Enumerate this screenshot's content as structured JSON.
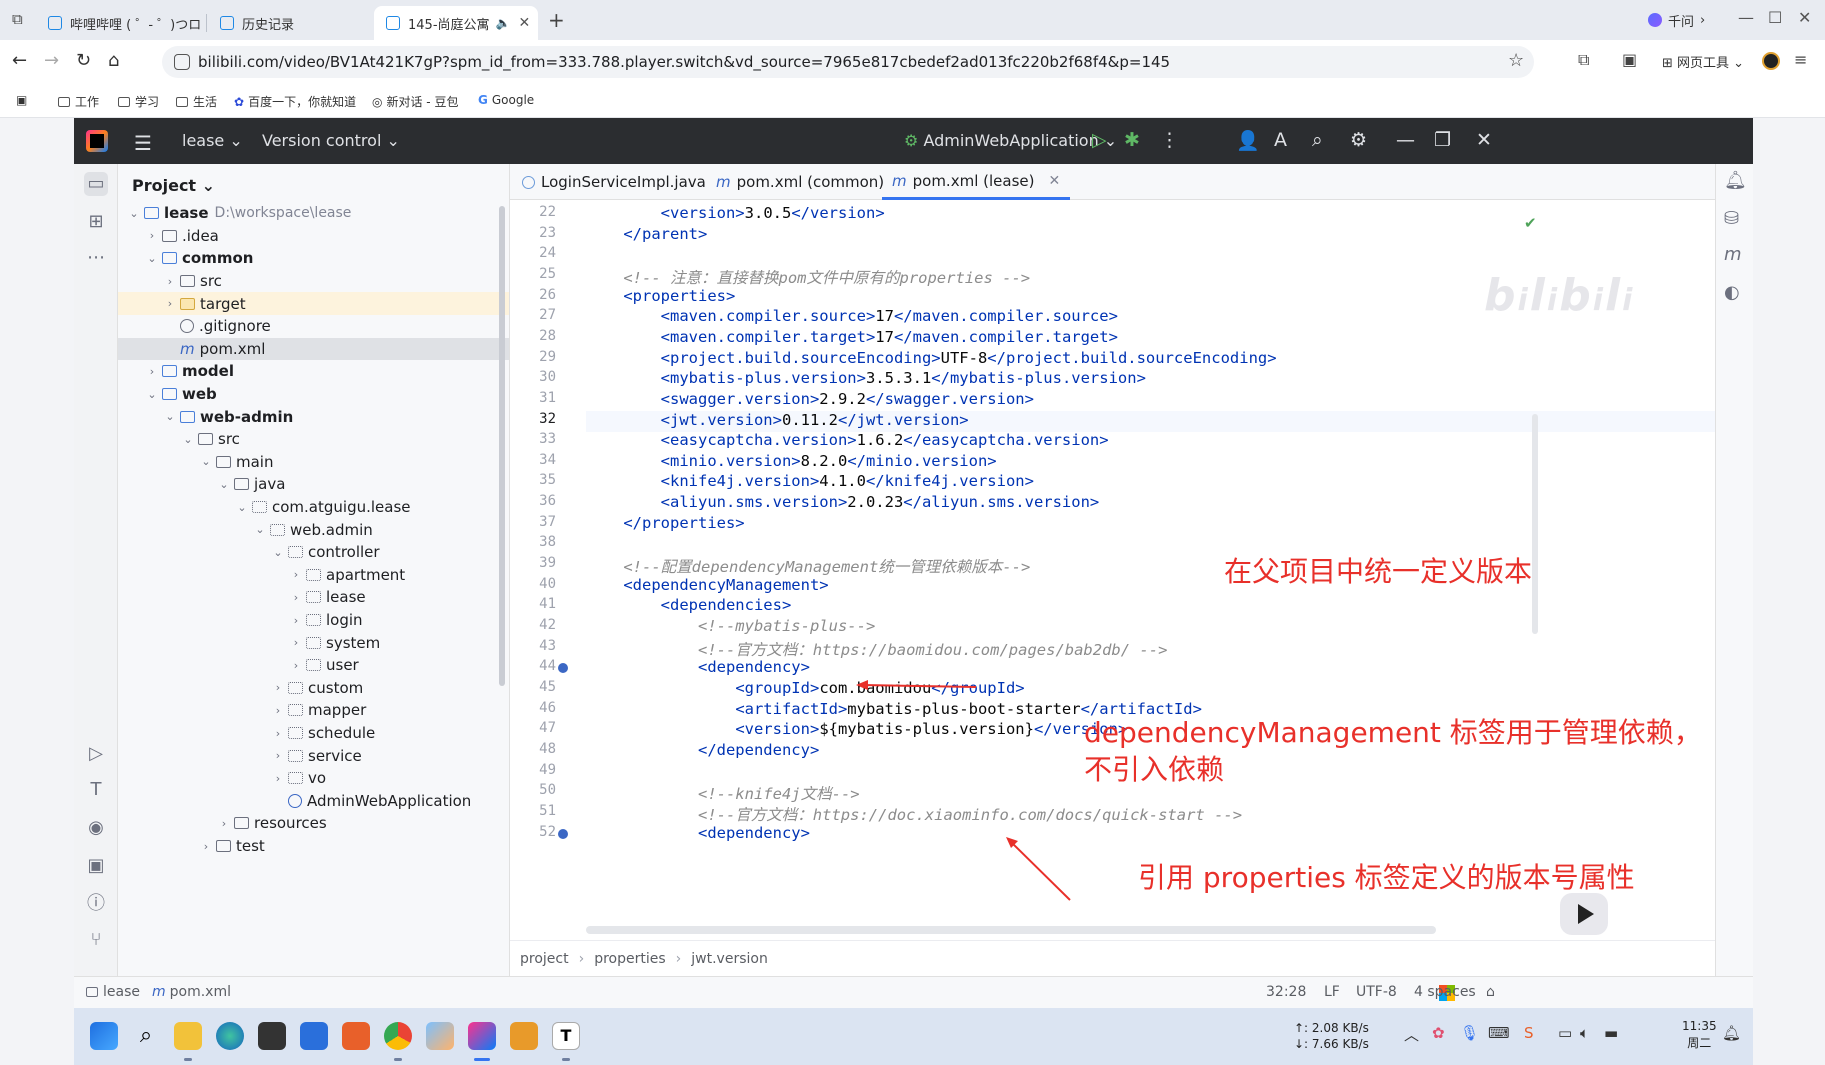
{
  "browser": {
    "tabs": [
      {
        "label": "哔哩哔哩 ( ゜- ゜)つロ",
        "active": false
      },
      {
        "label": "历史记录",
        "active": false
      },
      {
        "label": "145-尚庭公寓",
        "active": true
      }
    ],
    "qianwen_label": "千问",
    "url": "bilibili.com/video/BV1At421K7gP?spm_id_from=333.788.player.switch&vd_source=7965e817cbedef2ad013fc220b2f68f4&p=145",
    "webtools_label": "网页工具",
    "bookmarks": [
      "工作",
      "学习",
      "生活",
      "百度一下，你就知道",
      "新对话 - 豆包",
      "Google"
    ]
  },
  "ide": {
    "project_menu": "lease",
    "vcs_menu": "Version control",
    "run_config": "AdminWebApplication",
    "panel_title": "Project",
    "tree": [
      {
        "label": "lease",
        "path": "D:\\workspace\\lease",
        "depth": 0,
        "icon": "module",
        "open": true,
        "bold": true
      },
      {
        "label": ".idea",
        "depth": 1,
        "icon": "folder",
        "open": false
      },
      {
        "label": "common",
        "depth": 1,
        "icon": "module",
        "open": true,
        "bold": true
      },
      {
        "label": "src",
        "depth": 2,
        "icon": "folder",
        "open": false
      },
      {
        "label": "target",
        "depth": 2,
        "icon": "target",
        "open": false,
        "excluded": true
      },
      {
        "label": ".gitignore",
        "depth": 2,
        "icon": "ignore",
        "leaf": true
      },
      {
        "label": "pom.xml",
        "depth": 2,
        "icon": "maven",
        "leaf": true,
        "selected": true
      },
      {
        "label": "model",
        "depth": 1,
        "icon": "module",
        "open": false,
        "bold": true
      },
      {
        "label": "web",
        "depth": 1,
        "icon": "module",
        "open": true,
        "bold": true
      },
      {
        "label": "web-admin",
        "depth": 2,
        "icon": "module",
        "open": true,
        "bold": true
      },
      {
        "label": "src",
        "depth": 3,
        "icon": "folder",
        "open": true
      },
      {
        "label": "main",
        "depth": 4,
        "icon": "folder",
        "open": true
      },
      {
        "label": "java",
        "depth": 5,
        "icon": "folder",
        "open": true
      },
      {
        "label": "com.atguigu.lease",
        "depth": 6,
        "icon": "package",
        "open": true
      },
      {
        "label": "web.admin",
        "depth": 7,
        "icon": "package",
        "open": true
      },
      {
        "label": "controller",
        "depth": 8,
        "icon": "package",
        "open": true
      },
      {
        "label": "apartment",
        "depth": 9,
        "icon": "package",
        "open": false
      },
      {
        "label": "lease",
        "depth": 9,
        "icon": "package",
        "open": false
      },
      {
        "label": "login",
        "depth": 9,
        "icon": "package",
        "open": false
      },
      {
        "label": "system",
        "depth": 9,
        "icon": "package",
        "open": false
      },
      {
        "label": "user",
        "depth": 9,
        "icon": "package",
        "open": false
      },
      {
        "label": "custom",
        "depth": 8,
        "icon": "package",
        "open": false
      },
      {
        "label": "mapper",
        "depth": 8,
        "icon": "package",
        "open": false
      },
      {
        "label": "schedule",
        "depth": 8,
        "icon": "package",
        "open": false
      },
      {
        "label": "service",
        "depth": 8,
        "icon": "package",
        "open": false
      },
      {
        "label": "vo",
        "depth": 8,
        "icon": "package",
        "open": false
      },
      {
        "label": "AdminWebApplication",
        "depth": 8,
        "icon": "class",
        "leaf": true
      },
      {
        "label": "resources",
        "depth": 5,
        "icon": "folder",
        "open": false
      },
      {
        "label": "test",
        "depth": 4,
        "icon": "folder",
        "open": false
      }
    ],
    "editor_tabs": [
      {
        "label": "LoginServiceImpl.java",
        "icon": "class",
        "active": false
      },
      {
        "label": "pom.xml (common)",
        "icon": "maven",
        "active": false
      },
      {
        "label": "pom.xml (lease)",
        "icon": "maven",
        "active": true
      }
    ],
    "current_line": 32,
    "code": [
      {
        "n": 22,
        "text": "        <version>3.0.5</version>"
      },
      {
        "n": 23,
        "text": "    </parent>"
      },
      {
        "n": 24,
        "text": ""
      },
      {
        "n": 25,
        "text": "    <!-- 注意：直接替换pom文件中原有的properties -->"
      },
      {
        "n": 26,
        "text": "    <properties>"
      },
      {
        "n": 27,
        "text": "        <maven.compiler.source>17</maven.compiler.source>"
      },
      {
        "n": 28,
        "text": "        <maven.compiler.target>17</maven.compiler.target>"
      },
      {
        "n": 29,
        "text": "        <project.build.sourceEncoding>UTF-8</project.build.sourceEncoding>"
      },
      {
        "n": 30,
        "text": "        <mybatis-plus.version>3.5.3.1</mybatis-plus.version>"
      },
      {
        "n": 31,
        "text": "        <swagger.version>2.9.2</swagger.version>"
      },
      {
        "n": 32,
        "text": "        <jwt.version>0.11.2</jwt.version>"
      },
      {
        "n": 33,
        "text": "        <easycaptcha.version>1.6.2</easycaptcha.version>"
      },
      {
        "n": 34,
        "text": "        <minio.version>8.2.0</minio.version>"
      },
      {
        "n": 35,
        "text": "        <knife4j.version>4.1.0</knife4j.version>"
      },
      {
        "n": 36,
        "text": "        <aliyun.sms.version>2.0.23</aliyun.sms.version>"
      },
      {
        "n": 37,
        "text": "    </properties>"
      },
      {
        "n": 38,
        "text": ""
      },
      {
        "n": 39,
        "text": "    <!--配置dependencyManagement统一管理依赖版本-->"
      },
      {
        "n": 40,
        "text": "    <dependencyManagement>"
      },
      {
        "n": 41,
        "text": "        <dependencies>"
      },
      {
        "n": 42,
        "text": "            <!--mybatis-plus-->"
      },
      {
        "n": 43,
        "text": "            <!--官方文档：https://baomidou.com/pages/bab2db/ -->"
      },
      {
        "n": 44,
        "text": "            <dependency>"
      },
      {
        "n": 45,
        "text": "                <groupId>com.baomidou</groupId>"
      },
      {
        "n": 46,
        "text": "                <artifactId>mybatis-plus-boot-starter</artifactId>"
      },
      {
        "n": 47,
        "text": "                <version>${mybatis-plus.version}</version>"
      },
      {
        "n": 48,
        "text": "            </dependency>"
      },
      {
        "n": 49,
        "text": ""
      },
      {
        "n": 50,
        "text": "            <!--knife4j文档-->"
      },
      {
        "n": 51,
        "text": "            <!--官方文档：https://doc.xiaominfo.com/docs/quick-start -->"
      },
      {
        "n": 52,
        "text": "            <dependency>"
      }
    ],
    "breadcrumb": [
      "project",
      "properties",
      "jwt.version"
    ],
    "status": {
      "path_root": "lease",
      "path_file": "pom.xml",
      "position": "32:28",
      "line_sep": "LF",
      "encoding": "UTF-8",
      "indent": "4 spaces"
    }
  },
  "annotations": {
    "a1": "在父项目中统一定义版本",
    "a2_line1": "dependencyManagement 标签用于管理依赖，",
    "a2_line2": "不引入依赖",
    "a3": "引用 properties 标签定义的版本号属性",
    "color": "#e8302a"
  },
  "taskbar": {
    "net_up": "↑: 2.08 KB/s",
    "net_down": "↓: 7.66 KB/s",
    "time": "11:35",
    "day": "周二"
  }
}
